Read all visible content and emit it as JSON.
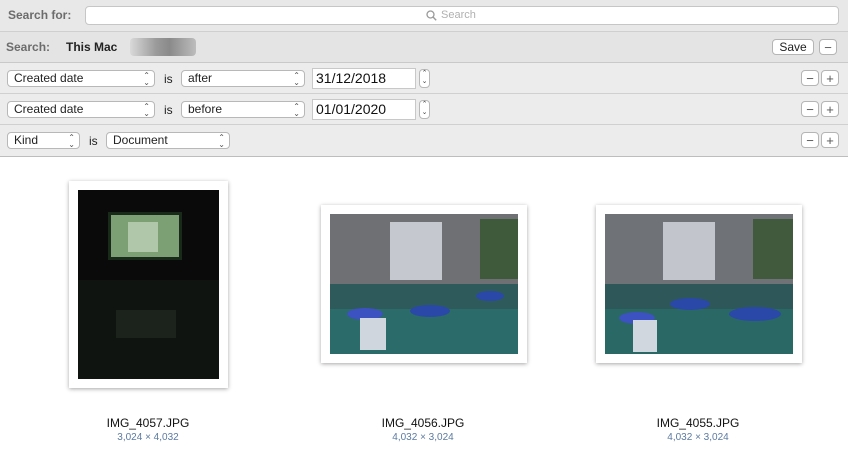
{
  "search_bar": {
    "label": "Search for:",
    "placeholder": "Search",
    "value": ""
  },
  "scope_bar": {
    "label": "Search:",
    "scope": "This Mac",
    "save_label": "Save",
    "remove_label": "−"
  },
  "criteria": [
    {
      "attribute": "Created date",
      "operator_text": "is",
      "comparison": "after",
      "date": "31/12/2018"
    },
    {
      "attribute": "Created date",
      "operator_text": "is",
      "comparison": "before",
      "date": "01/01/2020"
    },
    {
      "attribute": "Kind",
      "operator_text": "is",
      "comparison": "Document"
    }
  ],
  "row_buttons": {
    "remove": "−",
    "add": "+"
  },
  "results": [
    {
      "name": "IMG_4057.JPG",
      "dimensions": "3,024 × 4,032"
    },
    {
      "name": "IMG_4056.JPG",
      "dimensions": "4,032 × 3,024"
    },
    {
      "name": "IMG_4055.JPG",
      "dimensions": "4,032 × 3,024"
    }
  ],
  "icons": [
    "search-icon",
    "popup-arrows-icon",
    "stepper-icon",
    "minus-icon",
    "plus-icon"
  ]
}
